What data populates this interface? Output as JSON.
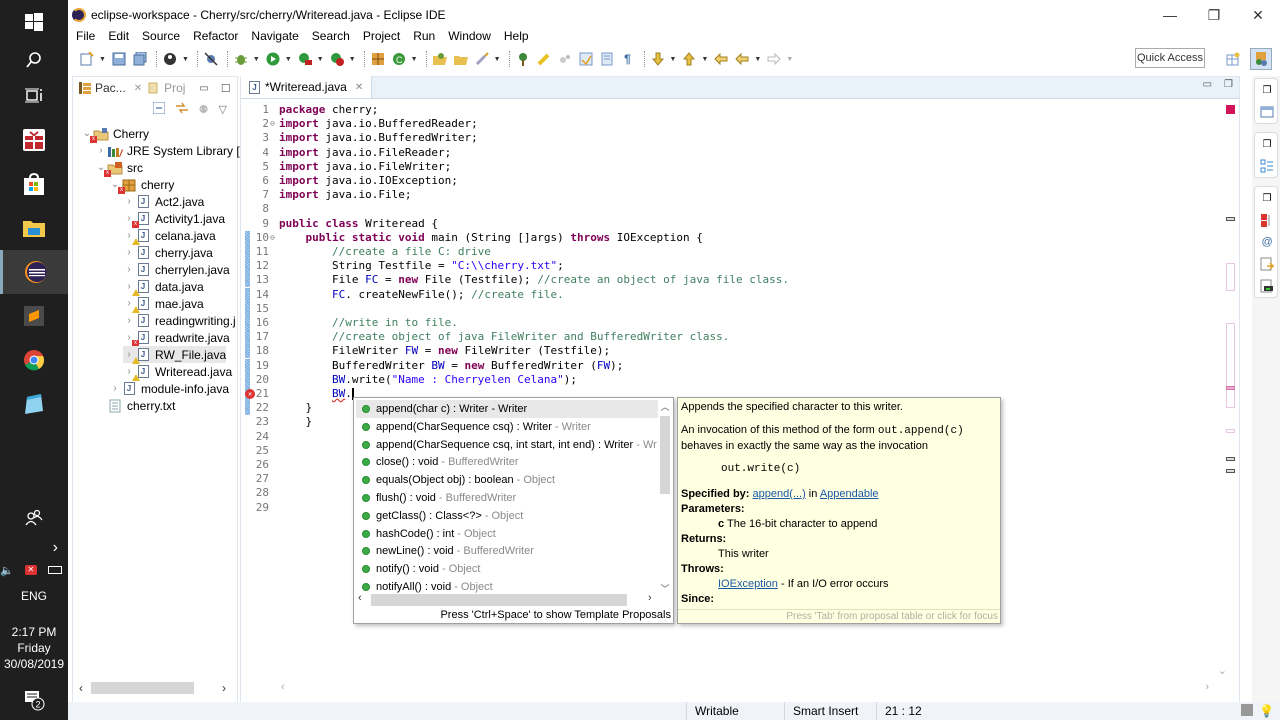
{
  "taskbar": {
    "icons": [
      "windows-start-icon",
      "search-icon",
      "task-view-icon",
      "gift-app-icon",
      "store-icon",
      "file-explorer-icon",
      "eclipse-icon",
      "sublime-text-icon",
      "chrome-icon",
      "notepad-icon"
    ],
    "tray": {
      "language": "ENG",
      "time": "2:17 PM",
      "day": "Friday",
      "date": "30/08/2019",
      "notification_count": "2"
    }
  },
  "window": {
    "title": "eclipse-workspace - Cherry/src/cherry/Writeread.java - Eclipse IDE",
    "controls": {
      "minimize": "—",
      "restore": "❐",
      "close": "✕"
    }
  },
  "menu": [
    "File",
    "Edit",
    "Source",
    "Refactor",
    "Navigate",
    "Search",
    "Project",
    "Run",
    "Window",
    "Help"
  ],
  "toolbar": {
    "quick_access": "Quick Access"
  },
  "left_panel": {
    "tabs": [
      {
        "label": "Pac...",
        "active": true
      },
      {
        "label": "Proj",
        "active": false
      }
    ],
    "tree": [
      {
        "label": "Cherry",
        "level": 0,
        "expanded": true,
        "type": "project",
        "badge": "error"
      },
      {
        "label": "JRE System Library [Ja",
        "level": 1,
        "expanded": false,
        "type": "library",
        "badge": ""
      },
      {
        "label": "src",
        "level": 1,
        "expanded": true,
        "type": "src",
        "badge": "error"
      },
      {
        "label": "cherry",
        "level": 2,
        "expanded": true,
        "type": "package",
        "badge": "error"
      },
      {
        "label": "Act2.java",
        "level": 3,
        "type": "java",
        "badge": ""
      },
      {
        "label": "Activity1.java",
        "level": 3,
        "type": "java",
        "badge": "error"
      },
      {
        "label": "celana.java",
        "level": 3,
        "type": "java",
        "badge": "warning"
      },
      {
        "label": "cherry.java",
        "level": 3,
        "type": "java",
        "badge": ""
      },
      {
        "label": "cherrylen.java",
        "level": 3,
        "type": "java",
        "badge": ""
      },
      {
        "label": "data.java",
        "level": 3,
        "type": "java",
        "badge": "warning"
      },
      {
        "label": "mae.java",
        "level": 3,
        "type": "java",
        "badge": "warning"
      },
      {
        "label": "readingwriting.j",
        "level": 3,
        "type": "java",
        "badge": ""
      },
      {
        "label": "readwrite.java",
        "level": 3,
        "type": "java",
        "badge": "error"
      },
      {
        "label": "RW_File.java",
        "level": 3,
        "type": "java",
        "badge": "warning",
        "selected": true
      },
      {
        "label": "Writeread.java",
        "level": 3,
        "type": "java",
        "badge": "warning"
      },
      {
        "label": "module-info.java",
        "level": 2,
        "type": "java",
        "badge": ""
      },
      {
        "label": "cherry.txt",
        "level": 1,
        "type": "text",
        "badge": "",
        "no_twisty": true
      }
    ]
  },
  "editor": {
    "tab_label": "*Writeread.java",
    "lines": [
      {
        "n": "1",
        "html": [
          [
            "kw",
            "package"
          ],
          [
            "",
            " cherry;"
          ]
        ]
      },
      {
        "n": "2",
        "fold": "⊖",
        "html": [
          [
            "kw",
            "import"
          ],
          [
            "",
            " java.io.BufferedReader;"
          ]
        ]
      },
      {
        "n": "3",
        "html": [
          [
            "kw",
            "import"
          ],
          [
            "",
            " java.io.BufferedWriter;"
          ]
        ]
      },
      {
        "n": "4",
        "html": [
          [
            "kw",
            "import"
          ],
          [
            "",
            " java.io.FileReader;"
          ]
        ]
      },
      {
        "n": "5",
        "html": [
          [
            "kw",
            "import"
          ],
          [
            "",
            " java.io.FileWriter;"
          ]
        ]
      },
      {
        "n": "6",
        "html": [
          [
            "kw",
            "import"
          ],
          [
            "",
            " java.io.IOException;"
          ]
        ]
      },
      {
        "n": "7",
        "html": [
          [
            "kw",
            "import"
          ],
          [
            "",
            " java.io.File;"
          ]
        ]
      },
      {
        "n": "8",
        "html": []
      },
      {
        "n": "9",
        "html": [
          [
            "kw",
            "public class"
          ],
          [
            "",
            " Writeread {"
          ]
        ]
      },
      {
        "n": "10",
        "fold": "⊖",
        "changed": true,
        "html": [
          [
            "",
            "    "
          ],
          [
            "kw",
            "public static void"
          ],
          [
            "",
            " main (String []args) "
          ],
          [
            "kw",
            "throws"
          ],
          [
            "",
            " IOException {"
          ]
        ]
      },
      {
        "n": "11",
        "changed": true,
        "html": [
          [
            "",
            "        "
          ],
          [
            "cm",
            "//create a file C: drive"
          ]
        ]
      },
      {
        "n": "12",
        "changed": true,
        "html": [
          [
            "",
            "        String Testfile = "
          ],
          [
            "st",
            "\"C:\\\\cherry.txt\""
          ],
          [
            "",
            ";"
          ]
        ]
      },
      {
        "n": "13",
        "changed": true,
        "html": [
          [
            "",
            "        File "
          ],
          [
            "fld",
            "FC"
          ],
          [
            "",
            " = "
          ],
          [
            "kw",
            "new"
          ],
          [
            "",
            " File (Testfile); "
          ],
          [
            "cm",
            "//create an object of java file class."
          ]
        ]
      },
      {
        "n": "14",
        "changed": true,
        "html": [
          [
            "",
            "        "
          ],
          [
            "fld",
            "FC"
          ],
          [
            "",
            ". createNewFile(); "
          ],
          [
            "cm",
            "//create file."
          ]
        ]
      },
      {
        "n": "15",
        "changed": true,
        "html": []
      },
      {
        "n": "16",
        "changed": true,
        "html": [
          [
            "",
            "        "
          ],
          [
            "cm",
            "//write in to file."
          ]
        ]
      },
      {
        "n": "17",
        "changed": true,
        "html": [
          [
            "",
            "        "
          ],
          [
            "cm",
            "//create object of java FileWriter and BufferedWriter class."
          ]
        ]
      },
      {
        "n": "18",
        "changed": true,
        "html": [
          [
            "",
            "        FileWriter "
          ],
          [
            "fld",
            "FW"
          ],
          [
            "",
            " = "
          ],
          [
            "kw",
            "new"
          ],
          [
            "",
            " FileWriter (Testfile);"
          ]
        ]
      },
      {
        "n": "19",
        "changed": true,
        "html": [
          [
            "",
            "        BufferedWriter "
          ],
          [
            "fld",
            "BW"
          ],
          [
            "",
            " = "
          ],
          [
            "kw",
            "new"
          ],
          [
            "",
            " BufferedWriter ("
          ],
          [
            "fld",
            "FW"
          ],
          [
            "",
            ");"
          ]
        ]
      },
      {
        "n": "20",
        "changed": true,
        "html": [
          [
            "",
            "        "
          ],
          [
            "fld",
            "BW"
          ],
          [
            "",
            ".write("
          ],
          [
            "st",
            "\"Name : Cherryelen Celana\""
          ],
          [
            "",
            ");"
          ]
        ]
      },
      {
        "n": "21",
        "changed": true,
        "error": true,
        "html": [
          [
            "",
            "        "
          ],
          [
            "fld squiggle",
            "BW"
          ],
          [
            "",
            "."
          ],
          [
            "caret",
            ""
          ]
        ]
      },
      {
        "n": "22",
        "changed": true,
        "html": [
          [
            "",
            "    }"
          ]
        ]
      },
      {
        "n": "23",
        "html": [
          [
            "",
            "    }"
          ]
        ]
      },
      {
        "n": "24",
        "html": []
      },
      {
        "n": "25",
        "html": []
      },
      {
        "n": "26",
        "html": []
      },
      {
        "n": "27",
        "html": []
      },
      {
        "n": "28",
        "html": []
      },
      {
        "n": "29",
        "html": []
      }
    ]
  },
  "content_assist": {
    "proposals": [
      {
        "sig": "append(char c) : Writer - Writer",
        "owner": "",
        "selected": true
      },
      {
        "sig": "append(CharSequence csq) : Writer",
        "owner": "- Writer"
      },
      {
        "sig": "append(CharSequence csq, int start, int end) : Writer",
        "owner": "- Wr"
      },
      {
        "sig": "close() : void",
        "owner": "- BufferedWriter"
      },
      {
        "sig": "equals(Object obj) : boolean",
        "owner": "- Object"
      },
      {
        "sig": "flush() : void",
        "owner": "- BufferedWriter"
      },
      {
        "sig": "getClass() : Class<?>",
        "owner": "- Object"
      },
      {
        "sig": "hashCode() : int",
        "owner": "- Object"
      },
      {
        "sig": "newLine() : void",
        "owner": "- BufferedWriter"
      },
      {
        "sig": "notify() : void",
        "owner": "- Object"
      },
      {
        "sig": "notifyAll() : void",
        "owner": "- Object"
      }
    ],
    "status": "Press 'Ctrl+Space' to show Template Proposals"
  },
  "javadoc": {
    "summary": "Appends the specified character to this writer.",
    "desc_prefix": "An invocation of this method of the form ",
    "desc_code": "out.append(c)",
    "desc_suffix": "behaves in exactly the same way as the invocation",
    "code_block": "out.write(c)",
    "specified_by_label": "Specified by:",
    "specified_by_link": "append(...)",
    "specified_by_in": " in ",
    "specified_by_class": "Appendable",
    "parameters_label": "Parameters:",
    "param_name": "c",
    "param_desc": " The 16-bit character to append",
    "returns_label": "Returns:",
    "returns_desc": "This writer",
    "throws_label": "Throws:",
    "throws_link": "IOException",
    "throws_desc": " - If an I/O error occurs",
    "since_label": "Since:",
    "status": "Press 'Tab' from proposal table or click for focus"
  },
  "statusbar": {
    "mode": "Writable",
    "insert": "Smart Insert",
    "position": "21 : 12"
  }
}
